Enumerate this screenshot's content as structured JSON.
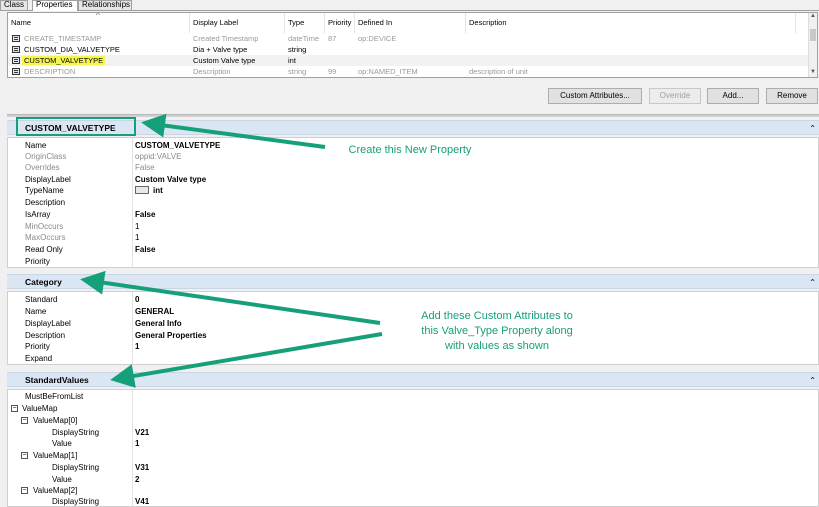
{
  "tabs": [
    "Class",
    "Properties",
    "Relationships"
  ],
  "grid": {
    "headers": [
      "Name",
      "Display Label",
      "Type",
      "Priority",
      "Defined In",
      "Description"
    ],
    "rows": [
      {
        "name": "CREATE_TIMESTAMP",
        "label": "Created Timestamp",
        "type": "dateTime",
        "priority": "87",
        "defined_in": "op:DEVICE",
        "desc": ""
      },
      {
        "name": "CUSTOM_DIA_VALVETYPE",
        "label": "Dia + Valve type",
        "type": "string",
        "priority": "",
        "defined_in": "",
        "desc": ""
      },
      {
        "name": "CUSTOM_VALVETYPE",
        "label": "Custom Valve type",
        "type": "int",
        "priority": "",
        "defined_in": "",
        "desc": ""
      },
      {
        "name": "DESCRIPTION",
        "label": "Description",
        "type": "string",
        "priority": "99",
        "defined_in": "op:NAMED_ITEM",
        "desc": "description of unit"
      }
    ]
  },
  "buttons": {
    "custom_attributes": "Custom Attributes...",
    "override": "Override",
    "add": "Add...",
    "remove": "Remove"
  },
  "property_section": {
    "title": "CUSTOM_VALVETYPE",
    "rows": [
      {
        "k": "Name",
        "v": "CUSTOM_VALVETYPE"
      },
      {
        "k": "OriginClass",
        "v": "oppid:VALVE"
      },
      {
        "k": "Overrides",
        "v": "False"
      },
      {
        "k": "DisplayLabel",
        "v": "Custom Valve type"
      },
      {
        "k": "TypeName",
        "v": "int"
      },
      {
        "k": "Description",
        "v": ""
      },
      {
        "k": "IsArray",
        "v": "False"
      },
      {
        "k": "MinOccurs",
        "v": "1"
      },
      {
        "k": "MaxOccurs",
        "v": "1"
      },
      {
        "k": "Read Only",
        "v": "False"
      },
      {
        "k": "Priority",
        "v": ""
      }
    ]
  },
  "category_section": {
    "title": "Category",
    "rows": [
      {
        "k": "Standard",
        "v": "0"
      },
      {
        "k": "Name",
        "v": "GENERAL"
      },
      {
        "k": "DisplayLabel",
        "v": "General Info"
      },
      {
        "k": "Description",
        "v": "General Properties"
      },
      {
        "k": "Priority",
        "v": "1"
      },
      {
        "k": "Expand",
        "v": ""
      }
    ]
  },
  "standard_values_section": {
    "title": "StandardValues",
    "rows": [
      {
        "k": "MustBeFromList",
        "v": ""
      },
      {
        "k": "ValueMap",
        "v": ""
      },
      {
        "k": "ValueMap[0]",
        "v": ""
      },
      {
        "k": "DisplayString",
        "v": "V21"
      },
      {
        "k": "Value",
        "v": "1"
      },
      {
        "k": "ValueMap[1]",
        "v": ""
      },
      {
        "k": "DisplayString",
        "v": "V31"
      },
      {
        "k": "Value",
        "v": "2"
      },
      {
        "k": "ValueMap[2]",
        "v": ""
      },
      {
        "k": "DisplayString",
        "v": "V41"
      }
    ]
  },
  "callouts": {
    "create": "Create this New Property",
    "add_attrs": [
      "Add these Custom Attributes to",
      "this Valve_Type Property along",
      "with values as shown"
    ]
  },
  "colors": {
    "callout": "#16a07a",
    "highlight": "#f5f54d",
    "section_header": "#dbe6f4"
  },
  "icons": {
    "property": "property-icon",
    "collapse": "chevron-up-icon",
    "tree_expander": "minus-box-icon"
  }
}
